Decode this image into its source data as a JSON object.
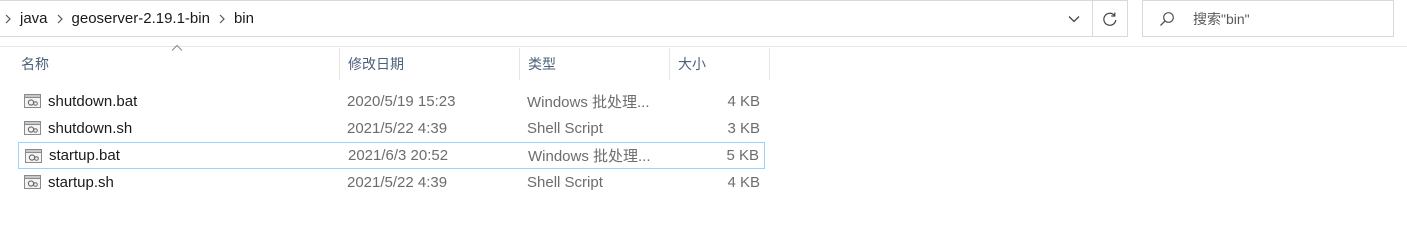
{
  "breadcrumb": {
    "items": [
      "java",
      "geoserver-2.19.1-bin",
      "bin"
    ]
  },
  "search": {
    "placeholder": "搜索\"bin\""
  },
  "columns": {
    "name": "名称",
    "date": "修改日期",
    "type": "类型",
    "size": "大小"
  },
  "files": [
    {
      "name": "shutdown.bat",
      "date": "2020/5/19 15:23",
      "type": "Windows 批处理...",
      "size": "4 KB"
    },
    {
      "name": "shutdown.sh",
      "date": "2021/5/22 4:39",
      "type": "Shell Script",
      "size": "3 KB"
    },
    {
      "name": "startup.bat",
      "date": "2021/6/3 20:52",
      "type": "Windows 批处理...",
      "size": "5 KB"
    },
    {
      "name": "startup.sh",
      "date": "2021/5/22 4:39",
      "type": "Shell Script",
      "size": "4 KB"
    }
  ],
  "selected_file": "startup.bat",
  "colors": {
    "header_text": "#4c607a",
    "selection_border": "#99d1ff",
    "secondary_text": "#6d6d6d"
  }
}
